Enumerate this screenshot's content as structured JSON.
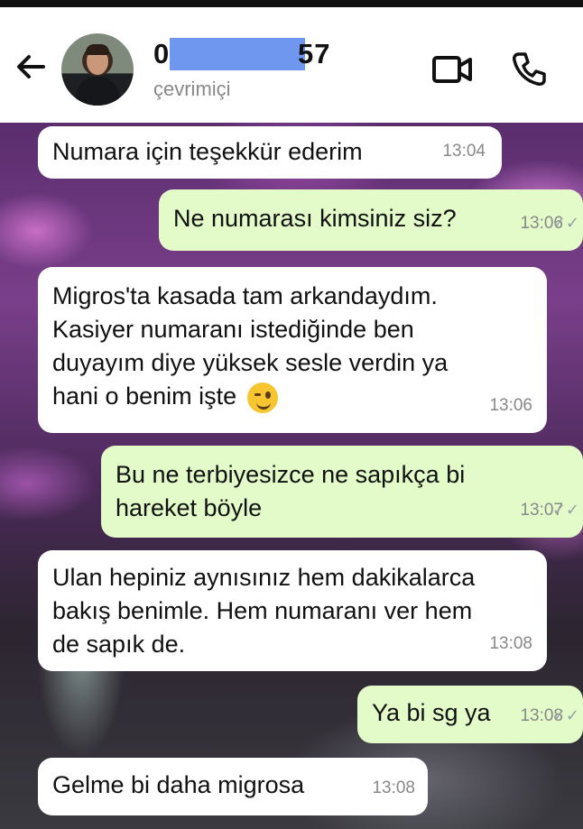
{
  "header": {
    "contact_prefix": "0",
    "contact_suffix": "57",
    "status": "çevrimiçi"
  },
  "icons": {
    "back": "arrow-left-icon",
    "avatar": "avatar",
    "video": "video-call-icon",
    "phone": "phone-icon"
  },
  "messages": [
    {
      "direction": "in",
      "text": "Numara için teşekkür ederim",
      "time": "13:04"
    },
    {
      "direction": "out",
      "text": "Ne numarası kimsiniz siz?",
      "time": "13:06"
    },
    {
      "direction": "in",
      "lines": [
        "Migros'ta kasada tam arkandaydım.",
        "Kasiyer numaranı istediğinde ben",
        "duyayım diye yüksek sesle verdin ya",
        "hani o benim işte"
      ],
      "time": "13:06"
    },
    {
      "direction": "out",
      "lines": [
        "Bu ne terbiyesizce ne sapıkça bi",
        "hareket böyle"
      ],
      "time": "13:07"
    },
    {
      "direction": "in",
      "lines": [
        "Ulan hepiniz aynısınız hem dakikalarca",
        "bakış benimle. Hem numaranı ver hem",
        "de sapık de."
      ],
      "time": "13:08"
    },
    {
      "direction": "out",
      "text": "Ya bi sg ya",
      "time": "13:08"
    },
    {
      "direction": "in",
      "text": "Gelme bi daha migrosa",
      "time": "13:08"
    }
  ],
  "colors": {
    "incoming_bubble": "#ffffff",
    "outgoing_bubble": "#e2fbc9",
    "redaction": "#6f97f0"
  }
}
